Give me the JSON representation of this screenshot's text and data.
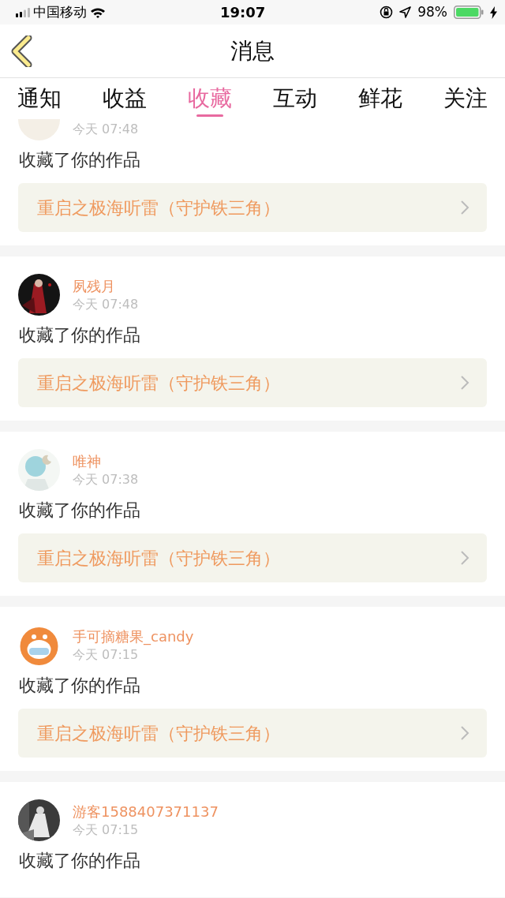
{
  "status_bar": {
    "carrier": "中国移动",
    "time": "19:07",
    "battery": "98%"
  },
  "header": {
    "title": "消息"
  },
  "tabs": [
    {
      "label": "通知",
      "selected": false
    },
    {
      "label": "收益",
      "selected": false
    },
    {
      "label": "收藏",
      "selected": true
    },
    {
      "label": "互动",
      "selected": false
    },
    {
      "label": "鲜花",
      "selected": false
    },
    {
      "label": "关注",
      "selected": false
    }
  ],
  "messages": [
    {
      "time": "今天 07:48",
      "action": "收藏了你的作品",
      "work": "重启之极海听雷（守护铁三角）"
    },
    {
      "name": "夙残月",
      "time": "今天 07:48",
      "action": "收藏了你的作品",
      "work": "重启之极海听雷（守护铁三角）"
    },
    {
      "name": "唯神",
      "time": "今天 07:38",
      "action": "收藏了你的作品",
      "work": "重启之极海听雷（守护铁三角）"
    },
    {
      "name": "手可摘糖果_candy",
      "time": "今天 07:15",
      "action": "收藏了你的作品",
      "work": "重启之极海听雷（守护铁三角）"
    },
    {
      "name": "游客1588407371137",
      "time": "今天 07:15",
      "action": "收藏了你的作品"
    }
  ]
}
